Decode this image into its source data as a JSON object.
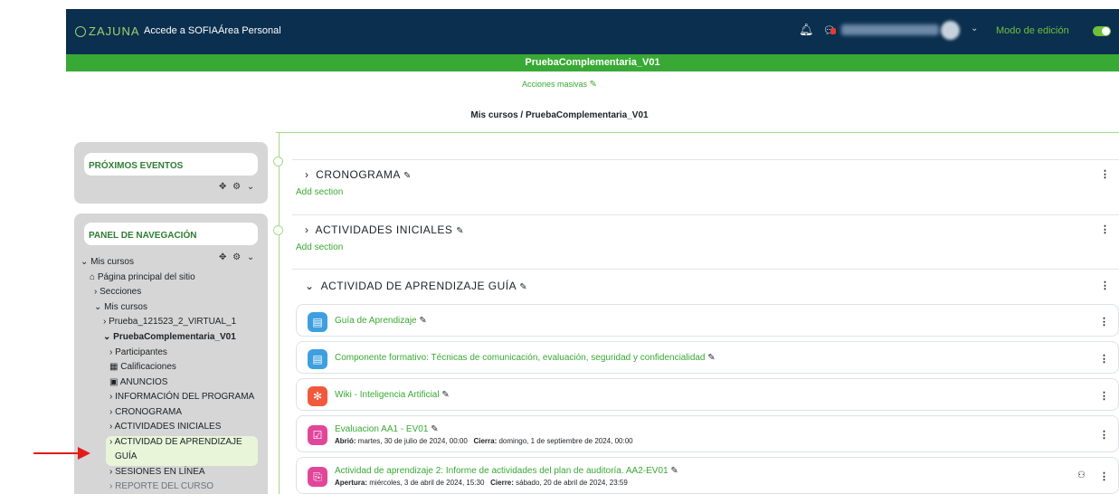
{
  "topbar": {
    "brand": "ZAJUNA",
    "links": [
      "Accede a SOFIA",
      "Área Personal"
    ],
    "edit_mode_label": "Modo de edición",
    "edit_mode_on": true
  },
  "course": {
    "title": "PruebaComplementaria_V01",
    "bulk_actions": "Acciones masivas",
    "breadcrumb": "Mis cursos / PruebaComplementaria_V01"
  },
  "blocks": {
    "events_title": "PRÓXIMOS EVENTOS",
    "nav_title": "PANEL DE NAVEGACIÓN",
    "nav_items": [
      "Mis cursos",
      "Página principal del sitio",
      "Secciones",
      "Mis cursos",
      "Prueba_121523_2_VIRTUAL_1",
      "PruebaComplementaria_V01",
      "Participantes",
      "Calificaciones",
      "ANUNCIOS",
      "INFORMACIÓN DEL PROGRAMA",
      "CRONOGRAMA",
      "ACTIVIDADES INICIALES",
      "ACTIVIDAD DE APRENDIZAJE",
      "GUÍA",
      "SESIONES EN LÍNEA",
      "REPORTE DEL CURSO"
    ]
  },
  "sections": {
    "s1": "CRONOGRAMA",
    "s2": "ACTIVIDADES INICIALES",
    "s3": "ACTIVIDAD DE APRENDIZAJE GUÍA",
    "add_section": "Add section"
  },
  "activities": [
    {
      "name": "Guía de Aprendizaje",
      "icon": "page-icon",
      "color": "#3d9fe0"
    },
    {
      "name": "Componente formativo: Técnicas de comunicación, evaluación, seguridad y confidencialidad",
      "icon": "page-icon",
      "color": "#3d9fe0"
    },
    {
      "name": "Wiki - Inteligencia Artificial",
      "icon": "wiki-icon",
      "color": "#f05a3c"
    },
    {
      "name": "Evaluacion AA1 - EV01",
      "icon": "quiz-icon",
      "color": "#e0479a",
      "dates": {
        "l1": "Abrió:",
        "v1": "martes, 30 de julio de 2024, 00:00",
        "l2": "Cierra:",
        "v2": "domingo, 1 de septiembre de 2024, 00:00"
      }
    },
    {
      "name": "Actividad de aprendizaje 2: Informe de actividades del plan de auditoría. AA2-EV01",
      "icon": "assignment-icon",
      "color": "#e0479a",
      "dates": {
        "l1": "Apertura:",
        "v1": "miércoles, 3 de abril de 2024, 15:30",
        "l2": "Cierre:",
        "v2": "sábado, 20 de abril de 2024, 23:59"
      }
    }
  ]
}
